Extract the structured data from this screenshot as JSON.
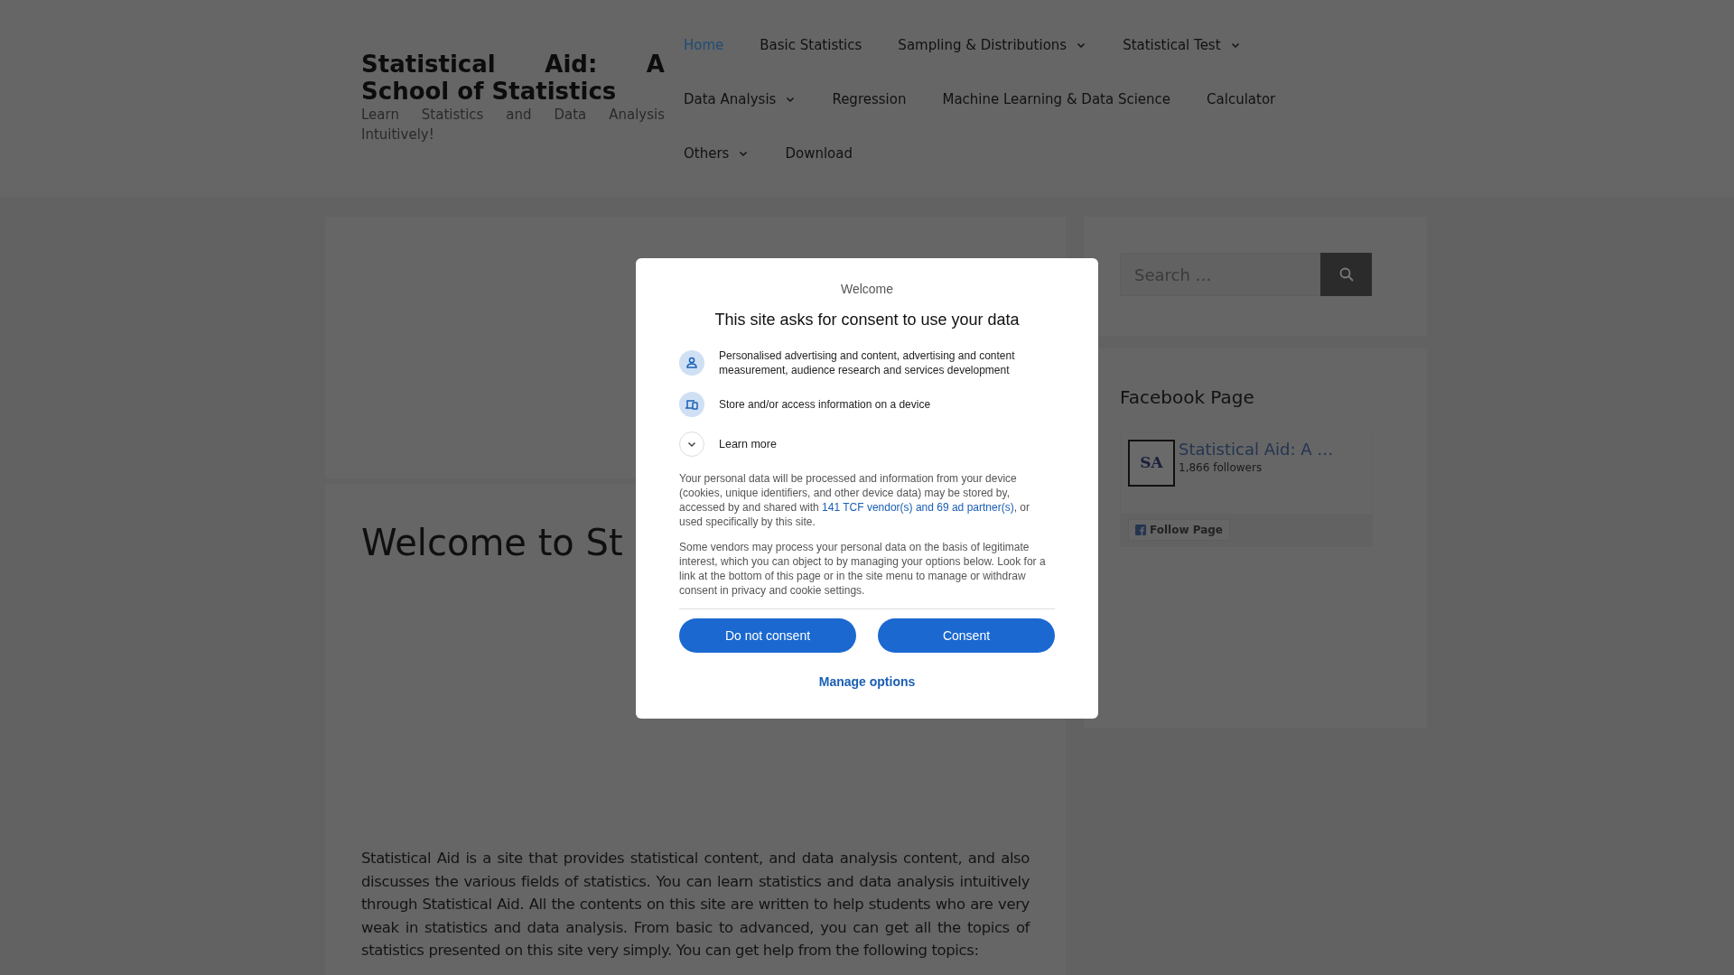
{
  "site": {
    "title": "Statistical Aid: A School of Statistics",
    "tagline": "Learn Statistics and Data Analysis Intuitively!"
  },
  "nav": [
    {
      "label": "Home",
      "selected": true,
      "dropdown": false
    },
    {
      "label": "Basic Statistics",
      "selected": false,
      "dropdown": false
    },
    {
      "label": "Sampling & Distributions",
      "selected": false,
      "dropdown": true
    },
    {
      "label": "Statistical Test",
      "selected": false,
      "dropdown": true
    },
    {
      "label": "Data Analysis",
      "selected": false,
      "dropdown": true
    },
    {
      "label": "Regression",
      "selected": false,
      "dropdown": false
    },
    {
      "label": "Machine Learning & Data Science",
      "selected": false,
      "dropdown": false
    },
    {
      "label": "Calculator",
      "selected": false,
      "dropdown": false
    },
    {
      "label": "Others",
      "selected": false,
      "dropdown": true
    },
    {
      "label": "Download",
      "selected": false,
      "dropdown": false
    }
  ],
  "main": {
    "heading": "Welcome to St",
    "paragraph": "Statistical Aid is a site that provides statistical content, and data analysis content, and also discusses the various fields of statistics. You can learn statistics and data analysis intuitively through Statistical Aid. All the contents on this site are written to help students who are very weak in statistics and data analysis. From basic to advanced, you can get all the topics of statistics presented on this site very simply. You can get help from the following topics:"
  },
  "sidebar": {
    "search": {
      "placeholder": "Search …"
    },
    "facebook": {
      "heading": "Facebook Page",
      "logo": "SA",
      "page_name": "Statistical Aid: A …",
      "followers": "1,866 followers",
      "follow_button": "Follow Page"
    }
  },
  "consent": {
    "eyebrow": "Welcome",
    "title": "This site asks for consent to use your data",
    "purposes": [
      {
        "kind": "person",
        "text": "Personalised advertising and content, advertising and content measurement, audience research and services development"
      },
      {
        "kind": "device",
        "text": "Store and/or access information on a device"
      }
    ],
    "learn_more": {
      "label": "Learn more",
      "expanded": false
    },
    "paragraph_1": {
      "before": "Your personal data will be processed and information from your device (cookies, unique identifiers, and other device data) may be stored by, accessed by and shared with ",
      "link": "141 TCF vendor(s) and 69 ad partner(s)",
      "after": ", or used specifically by this site."
    },
    "paragraph_2": "Some vendors may process your personal data on the basis of legitimate interest, which you can object to by managing your options below. Look for a link at the bottom of this page or in the site menu to manage or withdraw consent in privacy and cookie settings.",
    "buttons": [
      "Do not consent",
      "Consent"
    ],
    "manage": "Manage options"
  }
}
